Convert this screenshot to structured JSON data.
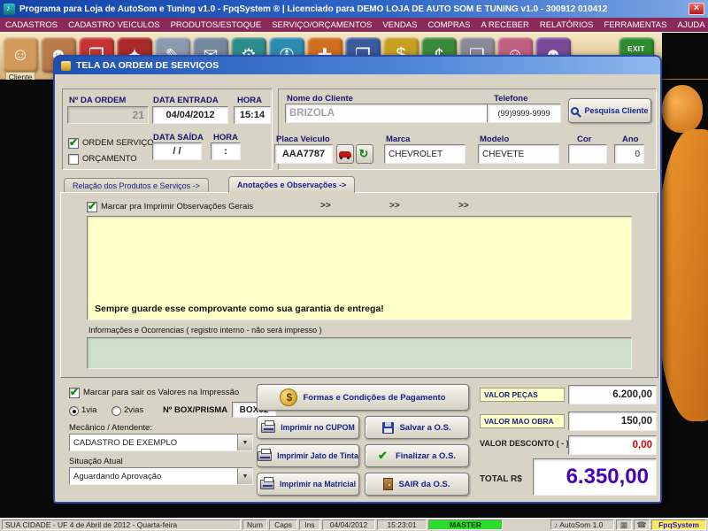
{
  "titlebar": {
    "title": "Programa para Loja de AutoSom e Tuning v1.0 - FpqSystem ® | Licenciado para  DEMO LOJA DE AUTO SOM E TUNING v1.0 - 300912 010412",
    "close": "×"
  },
  "menu": {
    "items": [
      "CADASTROS",
      "CADASTRO VEICULOS",
      "PRODUTOS/ESTOQUE",
      "SERVIÇO/ORÇAMENTOS",
      "VENDAS",
      "COMPRAS",
      "A RECEBER",
      "RELATÓRIOS",
      "FERRAMENTAS",
      "AJUDA"
    ]
  },
  "toolbar": {
    "icons": [
      {
        "name": "cliente",
        "glyph": "☺",
        "label": "Cliente"
      },
      {
        "name": "clientes-grupo",
        "glyph": "☻"
      },
      {
        "name": "produtos",
        "glyph": "❒"
      },
      {
        "name": "estoque",
        "glyph": "✦"
      },
      {
        "name": "cadastro-editar",
        "glyph": "✎"
      },
      {
        "name": "documentos",
        "glyph": "✉"
      },
      {
        "name": "servicos",
        "glyph": "⚙"
      },
      {
        "name": "veiculos",
        "glyph": "✇"
      },
      {
        "name": "vendas",
        "glyph": "✚"
      },
      {
        "name": "caixa",
        "glyph": "❐"
      },
      {
        "name": "contas-receber",
        "glyph": "$"
      },
      {
        "name": "financeiro",
        "glyph": "¢"
      },
      {
        "name": "relatorios",
        "glyph": "❑"
      },
      {
        "name": "usuaria",
        "glyph": "☺"
      },
      {
        "name": "usuario",
        "glyph": "☻"
      },
      {
        "name": "sair-sistema",
        "glyph": "➜",
        "label": "EXIT"
      }
    ]
  },
  "dialog": {
    "title": "TELA DA ORDEM DE SERVIÇOS",
    "ordem": {
      "numero_label": "Nº DA ORDEM",
      "numero_value": "21",
      "data_entrada_label": "DATA ENTRADA",
      "data_entrada_value": "04/04/2012",
      "hora_entrada_label": "HORA",
      "hora_entrada_value": "15:14",
      "ordem_servico_label": "ORDEM SERVIÇO",
      "orcamento_label": "ORÇAMENTO",
      "data_saida_label": "DATA SAÍDA",
      "data_saida_value": "/ /",
      "hora_saida_label": "HORA",
      "hora_saida_value": ":"
    },
    "cliente": {
      "nome_label": "Nome do Cliente",
      "nome_value": "BRIZOLA",
      "telefone_label": "Telefone",
      "telefone_value": "(99)9999-9999",
      "pesquisa_button": "Pesquisa Cliente",
      "placa_label": "Placa Veiculo",
      "placa_value": "AAA7787",
      "marca_label": "Marca",
      "marca_value": "CHEVROLET",
      "modelo_label": "Modelo",
      "modelo_value": "CHEVETE",
      "cor_label": "Cor",
      "cor_value": "",
      "ano_label": "Ano",
      "ano_value": "0"
    },
    "tabs": [
      {
        "label": "Relação dos Produtos e Serviços ->"
      },
      {
        "label": "Anotações e Observações ->"
      }
    ],
    "observacoes": {
      "marcar_label": "Marcar pra Imprimir Observações Gerais",
      "chevron": ">>",
      "texto": "Sempre guarde esse comprovante como sua garantia de entrega!",
      "info_label": "Informações e Ocorrencias ( registro interno - não será impresso )"
    },
    "opcoes": {
      "marcar_valores_label": "Marcar para sair os Valores na Impressão",
      "via1_label": "1via",
      "via2_label": "2vias",
      "box_label": "Nº BOX/PRISMA",
      "box_value": "BOX02",
      "mecanico_label": "Mecânico / Atendente:",
      "mecanico_value": "CADASTRO DE EXEMPLO",
      "situacao_label": "Situação Atual",
      "situacao_value": "Aguardando Aprovação"
    },
    "botoes": {
      "pagamento": "Formas e Condições de Pagamento",
      "cupom": "Imprimir no CUPOM",
      "salvar": "Salvar a O.S.",
      "jato": "Imprimir Jato de Tinta",
      "finalizar": "Finalizar a O.S.",
      "matricial": "Imprimir na Matricial",
      "sair": "SAIR da O.S."
    },
    "valores": {
      "pecas_label": "VALOR PEÇAS",
      "pecas_value": "6.200,00",
      "mao_obra_label": "VALOR MAO OBRA",
      "mao_obra_value": "150,00",
      "desconto_label": "VALOR DESCONTO ( - )",
      "desconto_value": "0,00",
      "total_label": "TOTAL R$",
      "total_value": "6.350,00"
    }
  },
  "statusbar": {
    "location_date": "SUA CIDADE - UF   4 de Abril de 2012 - Quarta-feira",
    "num": "Num",
    "caps": "Caps",
    "ins": "Ins",
    "date": "04/04/2012",
    "time": "15:23:01",
    "user": "MASTER",
    "app": "AutoSom 1.0",
    "brand": "FpqSystem"
  },
  "colors": {
    "titlebar_blue": "#1E50B0",
    "menu_maroon": "#8A2A5A",
    "toolbar_tan": "#E2C894",
    "master_green": "#2ADD2A",
    "total_purple": "#4A00B4",
    "desconto_red": "#D00000",
    "memo_yellow": "#FFFFC8",
    "memo_green": "#CFE0CA",
    "mascot_orange": "#E8821E"
  }
}
